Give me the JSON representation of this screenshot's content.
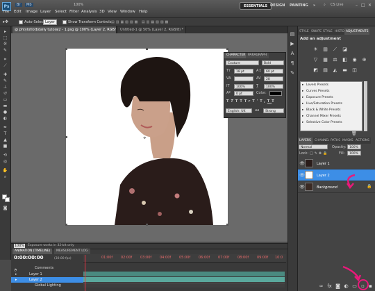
{
  "app": {
    "logo": "Ps",
    "br_label": "Br",
    "mb_label": "Mb",
    "zoom_label": "100%"
  },
  "menu": [
    "File",
    "Edit",
    "Image",
    "Layer",
    "Select",
    "Filter",
    "Analysis",
    "3D",
    "View",
    "Window",
    "Help"
  ],
  "workspaces": [
    "ESSENTIALS",
    "DESIGN",
    "PAINTING",
    "»"
  ],
  "cs_live": "CS Live",
  "options": {
    "auto_select": "Auto-Select:",
    "auto_select_value": "Layer",
    "show_transform": "Show Transform Controls"
  },
  "doc_tabs": [
    "@ phtylotlotbdaily tutoial2 - 1.psg @ 100% (Layer 2, RGB/8) *",
    "Untitled-1 @ 50% (Layer 2, RGB/8) *"
  ],
  "status": {
    "zoom": "100%",
    "text": "Exposure works in 32-bit only"
  },
  "animation": {
    "tabs": [
      "ANIMATION (TIMELINE)",
      "MEASUREMENT LOG"
    ],
    "timecode": "0:00:00:00",
    "fps": "(30.00 fps)",
    "ticks": [
      "01:00f",
      "02:00f",
      "03:00f",
      "04:00f",
      "05:00f",
      "06:00f",
      "07:00f",
      "08:00f",
      "09:00f",
      "10:0"
    ],
    "tracks": [
      "Comments",
      "Layer 1",
      "Layer 2",
      "Global Lighting"
    ]
  },
  "character": {
    "tabs": [
      "CHARACTER",
      "PARAGRAPH"
    ],
    "font": "Couture",
    "style": "Bold",
    "size": "18 pt",
    "leading": "60 pt",
    "kerning": "VA",
    "tracking": "28",
    "vscale": "100%",
    "hscale": "100%",
    "baseline": "0 pt",
    "color_label": "Color:",
    "style_buttons": [
      "T",
      "T",
      "TT",
      "Tr",
      "T'",
      "T,",
      "T",
      "Ŧ"
    ],
    "language": "English: UK",
    "aa_label": "aa",
    "aa": "Strong"
  },
  "adjustments": {
    "tabs": [
      "STYLE",
      "SWATC",
      "STYLE",
      "HISTO",
      "ADJUSTMENTS"
    ],
    "title": "Add an adjustment",
    "presets": [
      "Levels Presets",
      "Curves Presets",
      "Exposure Presets",
      "Hue/Saturation Presets",
      "Black & White Presets",
      "Channel Mixer Presets",
      "Selective Color Presets"
    ]
  },
  "layers": {
    "tabs": [
      "LAYERS",
      "CHANNEL",
      "PATHS",
      "MASKS",
      "ACTIONS"
    ],
    "blend_mode": "Normal",
    "opacity_label": "Opacity:",
    "opacity": "100%",
    "lock_label": "Lock:",
    "fill_label": "Fill:",
    "fill": "100%",
    "items": [
      {
        "name": "Layer 1",
        "selected": false,
        "italic": false
      },
      {
        "name": "Layer 2",
        "selected": true,
        "italic": false
      },
      {
        "name": "Background",
        "selected": false,
        "italic": true
      }
    ]
  },
  "colors": {
    "accent": "#3d8ee6",
    "annotation": "#e8197a",
    "selected_layer": "#3d8ee6"
  }
}
